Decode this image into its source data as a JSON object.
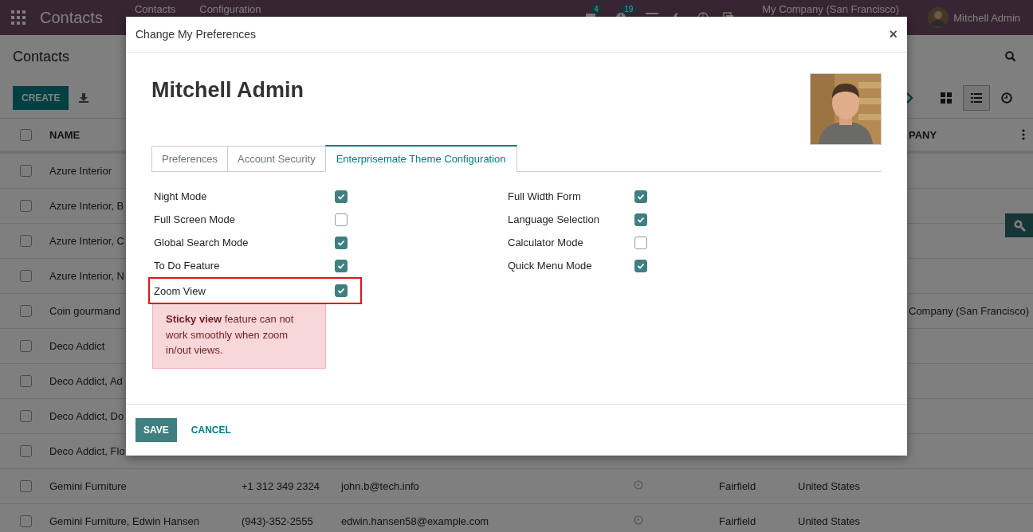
{
  "topbar": {
    "app": "Contacts",
    "menus": [
      "Contacts",
      "Configuration"
    ],
    "chat_badge": "4",
    "activity_badge": "19",
    "company": "My Company (San Francisco)",
    "user": "Mitchell Admin"
  },
  "control_panel": {
    "breadcrumb": "Contacts",
    "create": "CREATE"
  },
  "list": {
    "columns": [
      "NAME",
      "PANY"
    ],
    "select_all": false,
    "rows": [
      {
        "name": "Azure Interior",
        "selected": false
      },
      {
        "name": "Azure Interior, B",
        "selected": false
      },
      {
        "name": "Azure Interior, C",
        "selected": false
      },
      {
        "name": "Azure Interior, N",
        "selected": false
      },
      {
        "name": "Coin gourmand",
        "company": "Company (San Francisco)",
        "selected": false
      },
      {
        "name": "Deco Addict",
        "selected": false
      },
      {
        "name": "Deco Addict, Ad",
        "selected": false
      },
      {
        "name": "Deco Addict, Do",
        "selected": false
      },
      {
        "name": "Deco Addict, Flo",
        "selected": false
      },
      {
        "name": "Gemini Furniture",
        "selected": false,
        "phone": "+1 312 349 2324",
        "email": "john.b@tech.info",
        "activity": true,
        "city": "Fairfield",
        "country": "United States"
      },
      {
        "name": "Gemini Furniture, Edwin Hansen",
        "selected": false,
        "phone": "(943)-352-2555",
        "email": "edwin.hansen58@example.com",
        "activity": true,
        "city": "Fairfield",
        "country": "United States"
      }
    ]
  },
  "dialog": {
    "title": "Change My Preferences",
    "close": "×",
    "user_name": "Mitchell Admin",
    "tabs": [
      {
        "label": "Preferences",
        "selected": false
      },
      {
        "label": "Account Security",
        "selected": false
      },
      {
        "label": "Enterprisemate Theme Configuration",
        "selected": true
      }
    ],
    "left_fields": [
      {
        "label": "Night Mode",
        "checked": true,
        "highlighted": false
      },
      {
        "label": "Full Screen Mode",
        "checked": false,
        "highlighted": false
      },
      {
        "label": "Global Search Mode",
        "checked": true,
        "highlighted": false
      },
      {
        "label": "To Do Feature",
        "checked": true,
        "highlighted": false
      },
      {
        "label": "Zoom View",
        "checked": true,
        "highlighted": true
      }
    ],
    "right_fields": [
      {
        "label": "Full Width Form",
        "checked": true,
        "highlighted": false
      },
      {
        "label": "Language Selection",
        "checked": true,
        "highlighted": false
      },
      {
        "label": "Calculator Mode",
        "checked": false,
        "highlighted": false
      },
      {
        "label": "Quick Menu Mode",
        "checked": true,
        "highlighted": false
      }
    ],
    "warning": "**Sticky view** feature can not work smoothly when zoom in/out views.",
    "buttons": [
      {
        "label": "SAVE",
        "kind": "primary"
      },
      {
        "label": "CANCEL",
        "kind": "link"
      }
    ]
  }
}
